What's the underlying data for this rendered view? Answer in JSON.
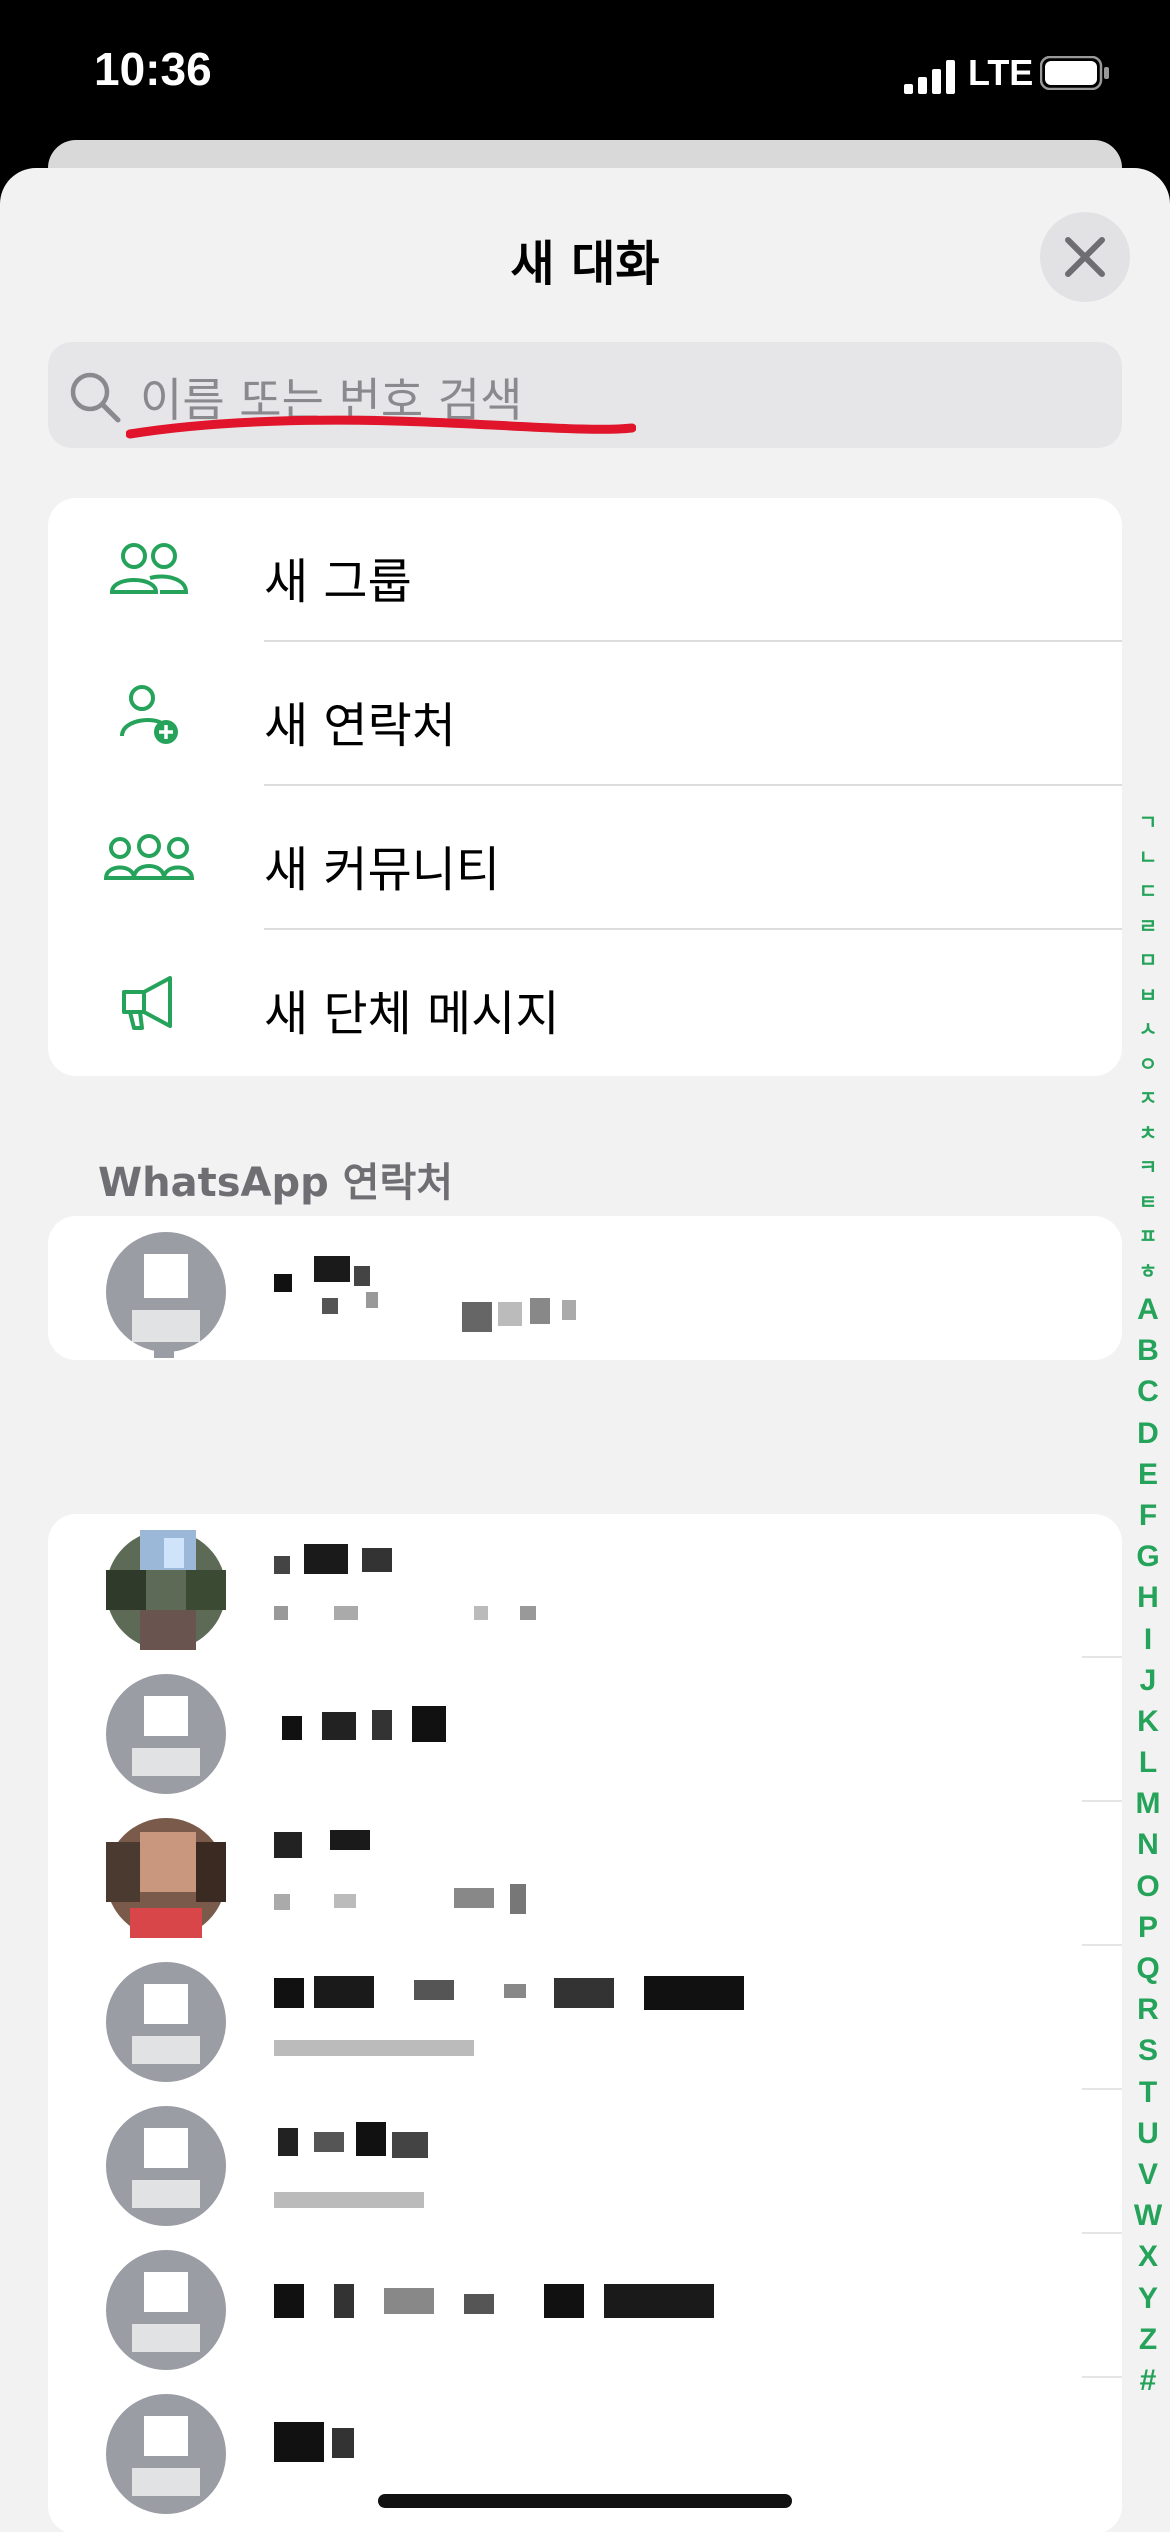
{
  "status_bar": {
    "time": "10:36",
    "network": "LTE"
  },
  "sheet": {
    "title": "새 대화"
  },
  "search": {
    "placeholder": "이름 또는 번호 검색"
  },
  "actions": [
    {
      "label": "새 그룹",
      "icon": "group-icon"
    },
    {
      "label": "새 연락처",
      "icon": "add-contact-icon"
    },
    {
      "label": "새 커뮤니티",
      "icon": "community-icon"
    },
    {
      "label": "새 단체 메시지",
      "icon": "broadcast-icon"
    }
  ],
  "contacts_section": {
    "header": "WhatsApp 연락처"
  },
  "index_korean": [
    "ㄱ",
    "ㄴ",
    "ㄷ",
    "ㄹ",
    "ㅁ",
    "ㅂ",
    "ㅅ",
    "ㅇ",
    "ㅈ",
    "ㅊ",
    "ㅋ",
    "ㅌ",
    "ㅍ",
    "ㅎ"
  ],
  "index_latin": [
    "A",
    "B",
    "C",
    "D",
    "E",
    "F",
    "G",
    "H",
    "I",
    "J",
    "K",
    "L",
    "M",
    "N",
    "O",
    "P",
    "Q",
    "R",
    "S",
    "T",
    "U",
    "V",
    "W",
    "X",
    "Y",
    "Z",
    "#"
  ],
  "colors": {
    "accent": "#25a35a",
    "annotation_red": "#e0142a"
  }
}
